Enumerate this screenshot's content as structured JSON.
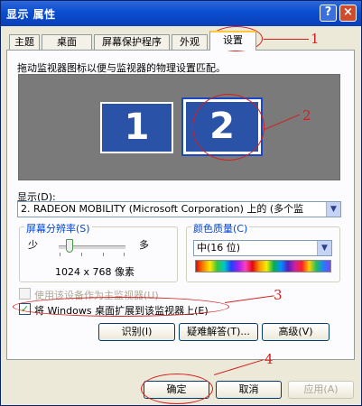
{
  "window": {
    "title": "显示 属性",
    "help": "?",
    "close": "×"
  },
  "tabs": [
    {
      "label": "主题"
    },
    {
      "label": "桌面"
    },
    {
      "label": "屏幕保护程序"
    },
    {
      "label": "外观"
    },
    {
      "label": "设置"
    }
  ],
  "settings": {
    "description": "拖动监视器图标以便与监视器的物理设置匹配。",
    "monitors": [
      {
        "number": "1"
      },
      {
        "number": "2"
      }
    ],
    "display_label": "显示(D):",
    "display_value": "2. RADEON MOBILITY (Microsoft Corporation) 上的 (多个监",
    "resolution": {
      "title": "屏幕分辨率(S)",
      "less": "少",
      "more": "多",
      "value": "1024 x 768 像素",
      "level": 0.1
    },
    "color": {
      "title": "颜色质量(C)",
      "value": "中(16 位)"
    },
    "primary_checkbox": {
      "label": "使用该设备作为主监视器(U)",
      "checked": false,
      "enabled": false
    },
    "extend_checkbox": {
      "label": "将 Windows 桌面扩展到该监视器上(E)",
      "checked": true
    },
    "buttons": {
      "identify": "识别(I)",
      "troubleshoot": "疑难解答(T)...",
      "advanced": "高级(V)"
    }
  },
  "footer": {
    "ok": "确定",
    "cancel": "取消",
    "apply": "应用(A)"
  },
  "annotations": [
    {
      "number": "1"
    },
    {
      "number": "2"
    },
    {
      "number": "3"
    },
    {
      "number": "4"
    }
  ],
  "colors": {
    "annotation": "#d31f1f",
    "titlebar": "#0a4ed1",
    "monitor": "#2a52a7"
  }
}
